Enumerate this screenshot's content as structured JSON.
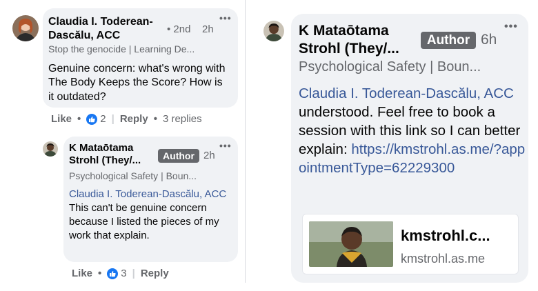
{
  "comments": {
    "first": {
      "author": "Claudia I. Toderean-Dascălu, ACC",
      "degree": "• 2nd",
      "time": "2h",
      "subtitle": "Stop the genocide | Learning De...",
      "text": "Genuine concern: what's wrong with The Body Keeps the Score? How is it outdated?",
      "actions": {
        "like": "Like",
        "reactions": "2",
        "reply": "Reply",
        "replies": "3 replies"
      }
    },
    "reply": {
      "author": "K Mataōtama Strohl (They/...",
      "badge": "Author",
      "time": "2h",
      "subtitle": "Psychological Safety | Boun...",
      "mention": "Claudia I. Toderean-Dascălu, ACC",
      "text": "This can't be genuine concern because I listed the pieces of my work that explain.",
      "actions": {
        "like": "Like",
        "reactions": "3",
        "reply": "Reply"
      }
    },
    "zoomed": {
      "author": "K Mataōtama Strohl (They/...",
      "badge": "Author",
      "time": "6h",
      "subtitle": "Psychological Safety | Boun...",
      "mention": "Claudia I. Toderean-Dascălu, ACC",
      "text": "understood. Feel free to book a session with this link so I can better explain:",
      "link": "https://kmstrohl.as.me/?appointmentType=62229300",
      "preview": {
        "title": "kmstrohl.c...",
        "domain": "kmstrohl.as.me"
      }
    }
  },
  "colors": {
    "link": "#385898",
    "bubble": "#f0f2f5",
    "meta": "#65676b",
    "badge": "#65676b",
    "like": "#1877f2"
  },
  "icons": {
    "more": "more-horizontal-icon",
    "like": "thumbs-up-icon"
  }
}
